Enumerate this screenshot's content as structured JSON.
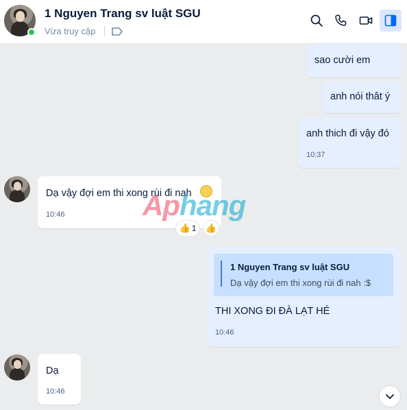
{
  "header": {
    "title": "1 Nguyen Trang sv luật SGU",
    "status": "Vừa truy cập"
  },
  "messages": [
    {
      "text": "sao cười em"
    },
    {
      "text": "anh nói thât ý"
    },
    {
      "text": "anh thich đi vậy đó",
      "time": "10:37"
    },
    {
      "text": "Dạ vậy đợi em thi xong rùi đi nah",
      "time": "10:46",
      "reactions": {
        "first_count": "1"
      }
    },
    {
      "quote_name": "1 Nguyen Trang sv luật SGU",
      "quote_text": "Dạ vậy đợi em thi xong rùi đi nah :$",
      "text": "THI XONG ĐI ĐÀ LẠT HÉ",
      "time": "10:46"
    },
    {
      "text": "Dạ",
      "time": "10:46"
    }
  ],
  "watermark": {
    "part1": "Ap",
    "part2": "hang"
  },
  "colors": {
    "accent": "#0068ff",
    "online": "#30c256",
    "my_bubble": "#e5efff",
    "quote_bg": "#c7e0ff"
  },
  "icons": [
    "search-icon",
    "phone-icon",
    "video-call-icon",
    "sidebar-toggle-icon",
    "tag-icon",
    "thumbs-up-icon",
    "chevron-down-icon"
  ]
}
